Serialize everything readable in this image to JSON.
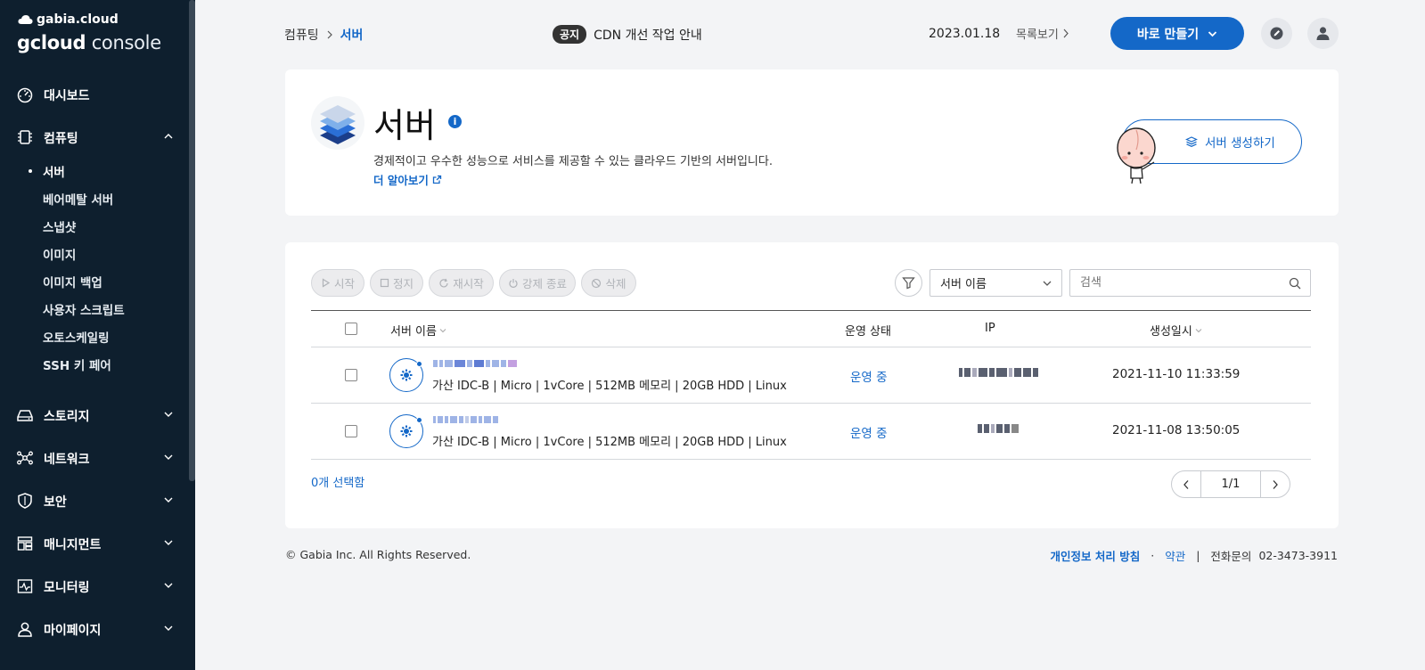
{
  "brand": {
    "top": "gabia.cloud",
    "main_bold": "gcloud",
    "main_light": "console"
  },
  "sidebar": {
    "items": [
      {
        "label": "대시보드",
        "icon": "dashboard-icon"
      },
      {
        "label": "컴퓨팅",
        "icon": "chip-icon",
        "expanded": true
      },
      {
        "label": "스토리지",
        "icon": "storage-icon"
      },
      {
        "label": "네트워크",
        "icon": "network-icon"
      },
      {
        "label": "보안",
        "icon": "shield-icon"
      },
      {
        "label": "매니지먼트",
        "icon": "management-icon"
      },
      {
        "label": "모니터링",
        "icon": "monitoring-icon"
      },
      {
        "label": "마이페이지",
        "icon": "user-icon"
      }
    ],
    "computing_sub": [
      "서버",
      "베어메탈 서버",
      "스냅샷",
      "이미지",
      "이미지 백업",
      "사용자 스크립트",
      "오토스케일링",
      "SSH 키 페어"
    ]
  },
  "header": {
    "breadcrumb": [
      "컴퓨팅",
      "서버"
    ],
    "notice_badge": "공지",
    "notice_text": "CDN 개선 작업 안내",
    "notice_date": "2023.01.18",
    "notice_list": "목록보기",
    "create_button": "바로 만들기"
  },
  "intro": {
    "title": "서버",
    "description": "경제적이고 우수한 성능으로 서비스를 제공할 수 있는 클라우드 기반의 서버입니다.",
    "learn_more": "더 알아보기",
    "create_server": "서버 생성하기"
  },
  "toolbar": {
    "start": "시작",
    "stop": "정지",
    "restart": "재시작",
    "force_stop": "강제 종료",
    "delete": "삭제",
    "select_value": "서버 이름",
    "search_placeholder": "검색"
  },
  "table": {
    "columns": [
      "서버 이름",
      "운영 상태",
      "IP",
      "생성일시"
    ],
    "rows": [
      {
        "spec": "가산 IDC-B  |  Micro  |  1vCore  |  512MB 메모리  |  20GB HDD  |  Linux",
        "status": "운영 중",
        "created": "2021-11-10 11:33:59"
      },
      {
        "spec": "가산 IDC-B  |  Micro  |  1vCore  |  512MB 메모리  |  20GB HDD  |  Linux",
        "status": "운영 중",
        "created": "2021-11-08 13:50:05"
      }
    ],
    "selected_count": "0개 선택함",
    "page": "1/1"
  },
  "footer": {
    "copyright": "© Gabia Inc. All Rights Reserved.",
    "privacy": "개인정보 처리 방침",
    "terms": "약관",
    "phone_label": "전화문의",
    "phone": "02-3473-3911"
  },
  "colors": {
    "accent": "#1468c8",
    "sidebar_bg": "#0e1f2e"
  }
}
